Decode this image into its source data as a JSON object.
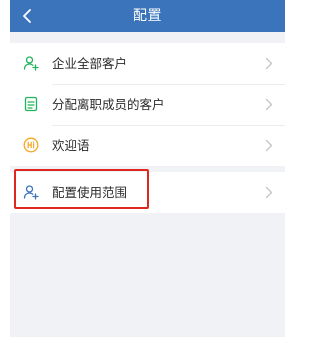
{
  "header": {
    "title": "配置"
  },
  "menu": {
    "items": [
      {
        "label": "企业全部客户",
        "icon": "user-group-icon"
      },
      {
        "label": "分配离职成员的客户",
        "icon": "document-list-icon"
      },
      {
        "label": "欢迎语",
        "icon": "hi-greeting-icon"
      }
    ],
    "scope_item": {
      "label": "配置使用范围",
      "icon": "user-add-icon"
    }
  },
  "colors": {
    "navbar": "#3c74bc",
    "icon_green": "#23b35a",
    "icon_yellow": "#f5a623",
    "icon_blue": "#3c74bc",
    "highlight": "#e0271f"
  }
}
